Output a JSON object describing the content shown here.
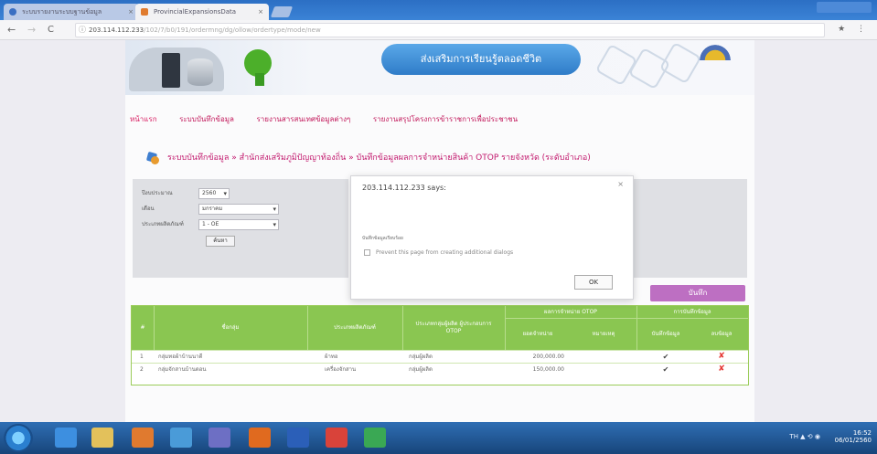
{
  "browser": {
    "tabs": [
      {
        "label": "ระบบรายงานระบบฐานข้อมูล",
        "active": false
      },
      {
        "label": "ProvincialExpansionsData",
        "active": true
      }
    ],
    "tab_close": "×",
    "address": {
      "host": "203.114.112.233",
      "rest": "/102/7/b0/191/ordermng/dg/ollow/ordertype/mode/new"
    },
    "nav": {
      "back": "←",
      "forward": "→",
      "reload": "C"
    },
    "toolbar_icons": "★ ⋮"
  },
  "site": {
    "banner_title": "ส่งเสริมการเรียนรู้ตลอดชีวิต",
    "menu": [
      "หน้าแรก",
      "ระบบบันทึกข้อมูล",
      "รายงานสารสนเทศข้อมูลต่างๆ",
      "รายงานสรุปโครงการข้าราชการเพื่อประชาชน"
    ],
    "breadcrumb": "ระบบบันทึกข้อมูล » สำนักส่งเสริมภูมิปัญญาท้องถิ่น » บันทึกข้อมูลผลการจำหน่ายสินค้า OTOP รายจังหวัด (ระดับอำเภอ)",
    "filters": [
      {
        "label": "ปีงบประมาณ",
        "value": "2560"
      },
      {
        "label": "เดือน",
        "value": "มกราคม"
      },
      {
        "label": "ประเภทผลิตภัณฑ์",
        "value": "1 - OE"
      }
    ],
    "search_label": "ค้นหา",
    "save_label": "บันทึก",
    "table": {
      "headers": {
        "no": "#",
        "name": "ชื่อกลุ่ม",
        "district": "ประเภทผลิตภัณฑ์",
        "product": "ประเภทกลุ่มผู้ผลิต ผู้ประกอบการ OTOP",
        "sales_group": "ผลการจำหน่าย OTOP",
        "sales_amount": "ยอดจำหน่าย",
        "sales_note": "หมายเหตุ",
        "status_group": "การบันทึกข้อมูล",
        "status_done": "บันทึกข้อมูล",
        "status_delete": "ลบข้อมูล"
      },
      "rows": [
        {
          "no": "1",
          "name": "กลุ่มทอผ้าบ้านนาดี",
          "district": "ผ้าทอ",
          "product": "กลุ่มผู้ผลิต",
          "amount": "200,000.00",
          "done": "✔",
          "delete": "✘"
        },
        {
          "no": "2",
          "name": "กลุ่มจักสานบ้านดอน",
          "district": "เครื่องจักสาน",
          "product": "กลุ่มผู้ผลิต",
          "amount": "150,000.00",
          "done": "✔",
          "delete": "✘"
        }
      ]
    }
  },
  "dialog": {
    "title": "203.114.112.233 says:",
    "close": "×",
    "message": "บันทึกข้อมูลเรียบร้อย",
    "checkbox_label": "Prevent this page from creating additional dialogs",
    "ok_label": "OK"
  },
  "taskbar": {
    "tray_icons": "TH ▲ ⟲ ◉",
    "time": "16:52",
    "date": "06/01/2560"
  }
}
